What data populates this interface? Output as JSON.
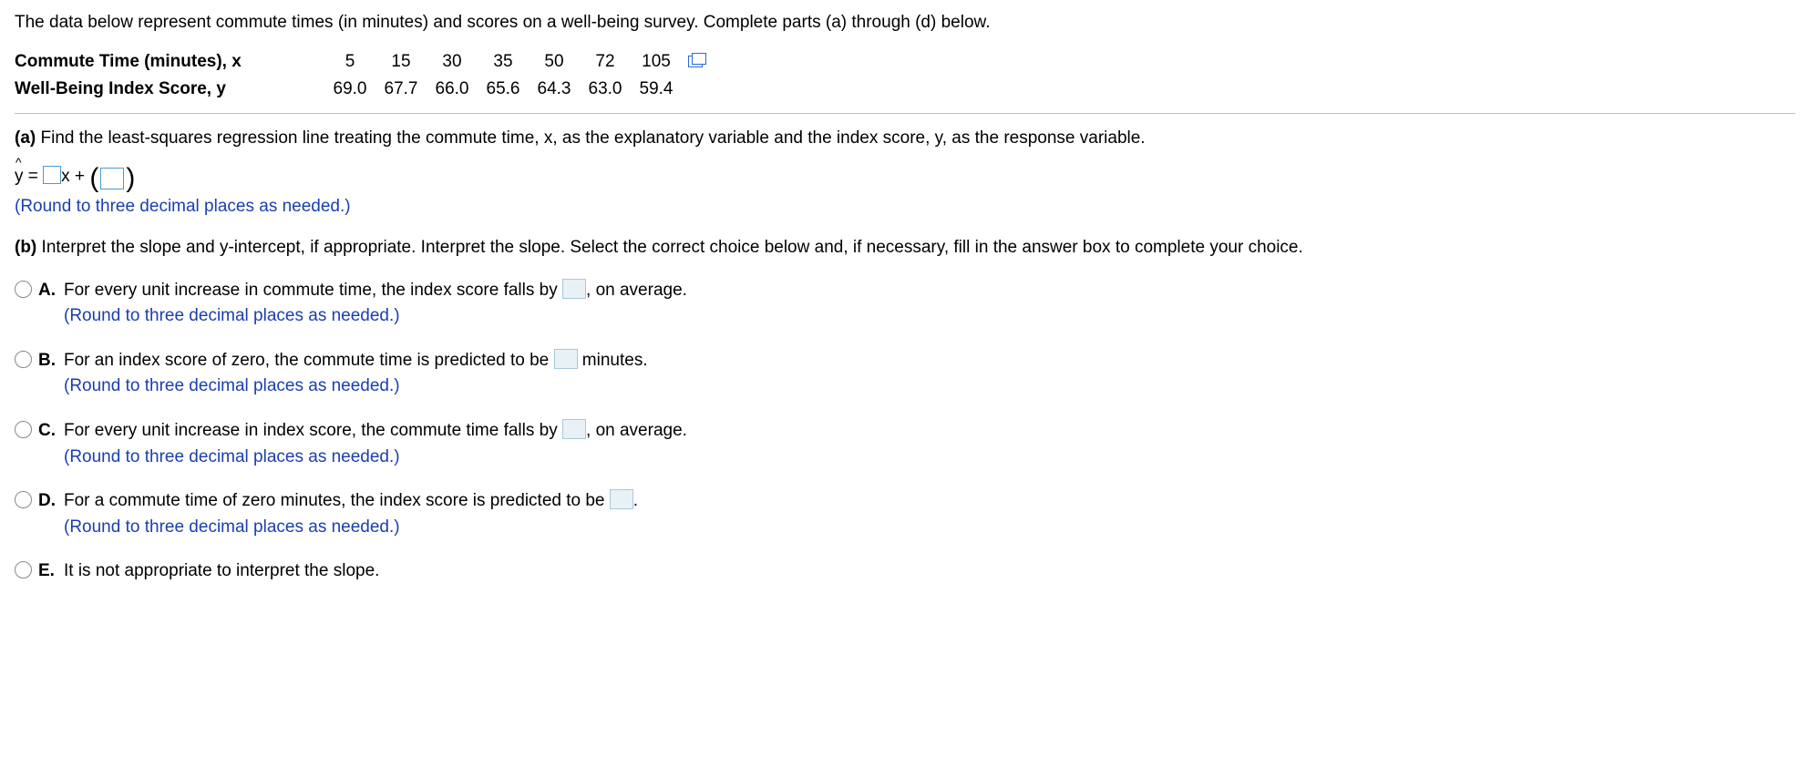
{
  "intro": "The data below represent commute times (in minutes) and scores on a well-being survey. Complete parts (a) through (d) below.",
  "row1_label": "Commute Time (minutes), x",
  "row2_label": "Well-Being Index Score, y",
  "x": [
    "5",
    "15",
    "30",
    "35",
    "50",
    "72",
    "105"
  ],
  "y": [
    "69.0",
    "67.7",
    "66.0",
    "65.6",
    "64.3",
    "63.0",
    "59.4"
  ],
  "part_a": {
    "label": "(a)",
    "text": "Find the least-squares regression line treating the commute time, x, as the explanatory variable and the index score, y, as the response variable.",
    "eq_prefix": "y",
    "eq_equals": " = ",
    "eq_x_plus": "x + ",
    "hint": "(Round to three decimal places as needed.)"
  },
  "part_b": {
    "label": "(b)",
    "text": "Interpret the slope and y-intercept, if appropriate. Interpret the slope. Select the correct choice below and, if necessary, fill in the answer box to complete your choice."
  },
  "choices": {
    "A": {
      "letter": "A.",
      "pre": "For every unit increase in commute time, the index score falls by ",
      "post": ", on average.",
      "hint": "(Round to three decimal places as needed.)"
    },
    "B": {
      "letter": "B.",
      "pre": "For an index score of zero, the commute time is predicted to be ",
      "post": " minutes.",
      "hint": "(Round to three decimal places as needed.)"
    },
    "C": {
      "letter": "C.",
      "pre": "For every unit increase in index score, the commute time falls by ",
      "post": ", on average.",
      "hint": "(Round to three decimal places as needed.)"
    },
    "D": {
      "letter": "D.",
      "pre": "For a commute time of zero minutes, the index score is predicted to be ",
      "post": ".",
      "hint": "(Round to three decimal places as needed.)"
    },
    "E": {
      "letter": "E.",
      "text": "It is not appropriate to interpret the slope."
    }
  }
}
